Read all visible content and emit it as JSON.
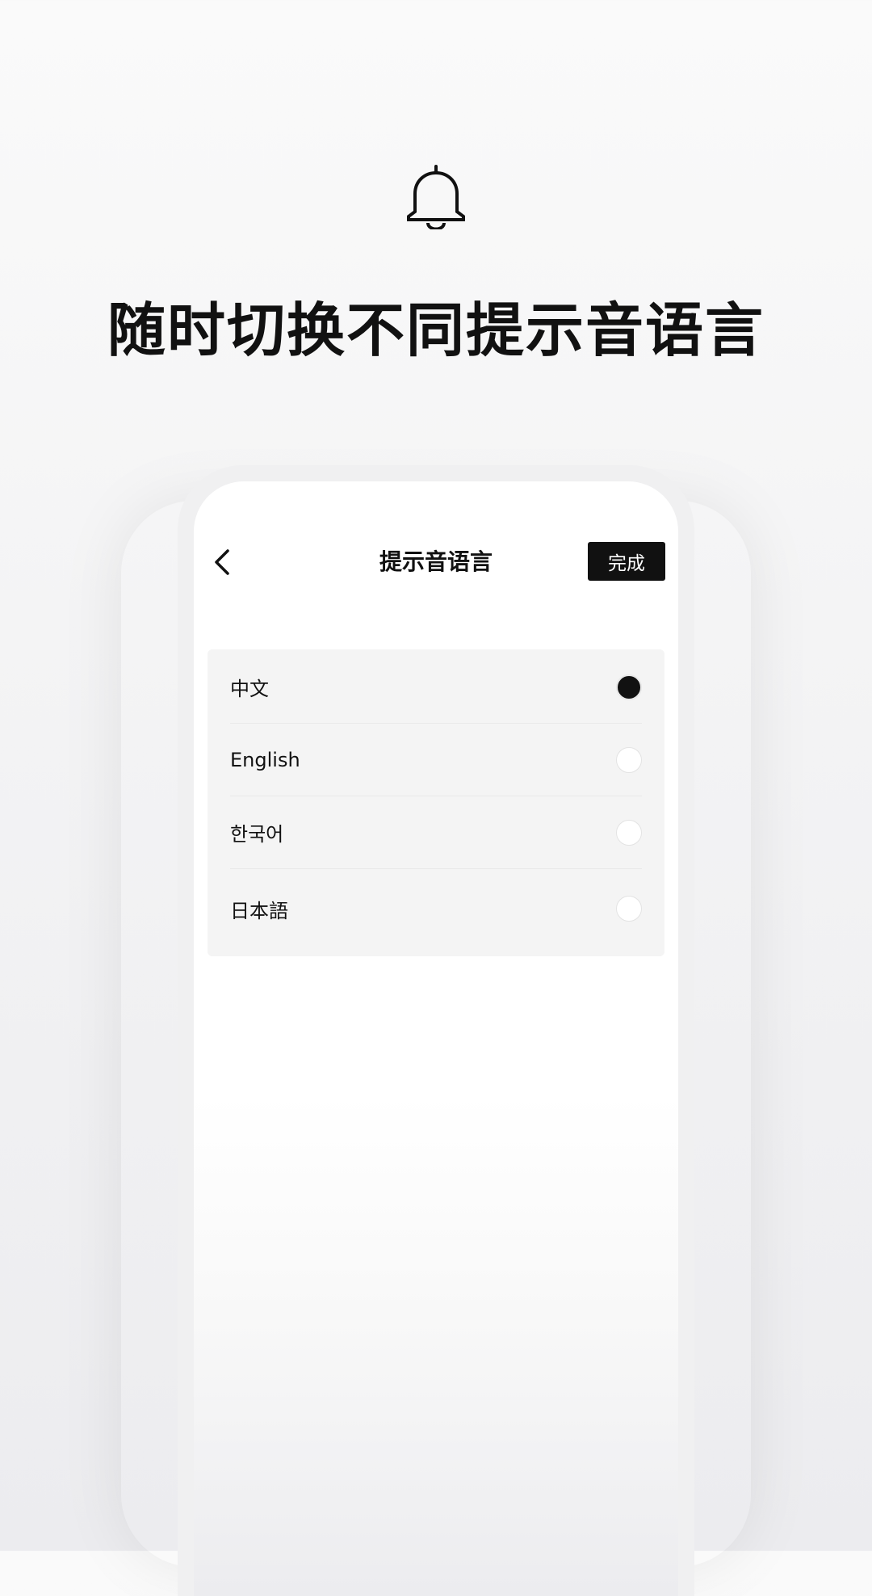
{
  "promo": {
    "icon": "bell-icon",
    "headline": "随时切换不同提示音语言"
  },
  "screen": {
    "title": "提示音语言",
    "back_icon": "chevron-left-icon",
    "done_label": "完成",
    "languages": [
      {
        "label": "中文",
        "selected": true
      },
      {
        "label": "English",
        "selected": false
      },
      {
        "label": "한국어",
        "selected": false
      },
      {
        "label": "日本語",
        "selected": false
      }
    ]
  }
}
